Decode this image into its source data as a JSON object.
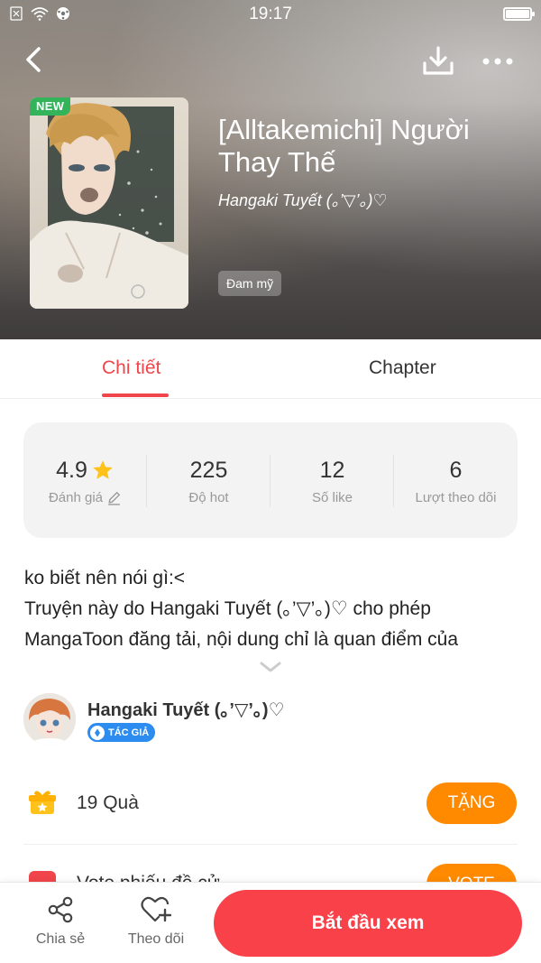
{
  "status_bar": {
    "time": "19:17"
  },
  "header": {
    "icons": [
      "back-arrow-icon",
      "download-icon",
      "more-icon"
    ]
  },
  "comic": {
    "badge": "NEW",
    "title": "[Alltakemichi] Người Thay Thế",
    "author": "Hangaki Tuyết (｡’▽’｡)♡",
    "genre": "Đam mỹ"
  },
  "tabs": [
    {
      "label": "Chi tiết",
      "active": true
    },
    {
      "label": "Chapter",
      "active": false
    }
  ],
  "stats": [
    {
      "value": "4.9",
      "label": "Đánh giá",
      "icon": "star-icon",
      "label_icon": "edit-icon"
    },
    {
      "value": "225",
      "label": "Độ hot"
    },
    {
      "value": "12",
      "label": "Số like"
    },
    {
      "value": "6",
      "label": "Lượt theo dõi"
    }
  ],
  "description": {
    "line1": "ko biết nên nói gì:<",
    "line2": "Truyện này do Hangaki Tuyết (｡’▽’｡)♡ cho phép",
    "line3": "MangaToon đăng tải, nội dung chỉ là quan điểm của"
  },
  "author_section": {
    "name": "Hangaki Tuyết (｡’▽’｡)♡",
    "badge": "TÁC GIẢ"
  },
  "gifts": {
    "count_text": "19  Quà",
    "button": "TẶNG"
  },
  "vote": {
    "text": "Vote phiếu đề cử",
    "button": "VOTE"
  },
  "bottom_bar": {
    "share_label": "Chia sẻ",
    "follow_label": "Theo dõi",
    "start_button": "Bắt đầu xem"
  },
  "colors": {
    "accent": "#f0454a",
    "start_button": "#f9414a",
    "gift_button": "#ff8a00",
    "new_badge": "#33b35a",
    "author_badge": "#2d8cf0",
    "star": "#ffc21a"
  }
}
